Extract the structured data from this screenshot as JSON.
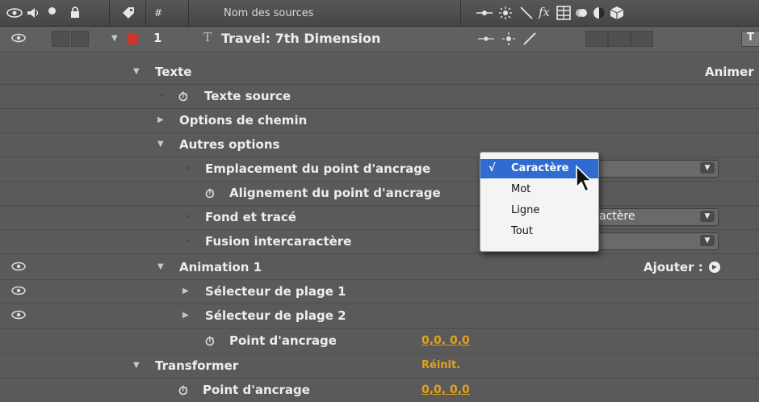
{
  "header": {
    "column_title": "Nom des sources",
    "left_icons": [
      "eye-icon",
      "speaker-icon",
      "solo-dot-icon",
      "lock-icon",
      "label-tag-icon",
      "hash-icon"
    ],
    "switch_icons": [
      "shy-icon",
      "collapse-sun-icon",
      "quality-slash-icon",
      "fx-icon",
      "frame-blend-icon",
      "motion-blur-icon",
      "adjustment-layer-icon",
      "3d-layer-icon"
    ],
    "fx_label": "fx"
  },
  "layer": {
    "number": "1",
    "type_glyph": "T",
    "name": "Travel: 7th Dimension",
    "label_color": "#d0352b",
    "right_cut": "T"
  },
  "rows": {
    "texte": "Texte",
    "animer_cut": "Animer",
    "texte_source": "Texte source",
    "options_chemin": "Options de chemin",
    "autres_options": "Autres options",
    "emplacement": "Emplacement du point d'ancrage",
    "alignement": "Alignement du point d'ancrage",
    "fond_trace": "Fond et tracé",
    "fond_trace_value": "actère",
    "fusion": "Fusion intercaractère",
    "animation1": "Animation 1",
    "ajouter": "Ajouter :",
    "selecteur1": "Sélecteur de plage 1",
    "selecteur2": "Sélecteur de plage 2",
    "point_ancrage_anim": "Point d'ancrage",
    "point_ancrage_anim_value": "0,0, 0,0",
    "transformer": "Transformer",
    "reinit": "Réinit.",
    "point_ancrage_tr": "Point d'ancrage",
    "point_ancrage_tr_value": "0,0, 0,0"
  },
  "dropdown_menu": {
    "checkmark": "√",
    "selected": "Caractère",
    "options": [
      "Caractère",
      "Mot",
      "Ligne",
      "Tout"
    ]
  },
  "colors": {
    "value_orange": "#e3a21e",
    "selection_blue": "#2f6bd0",
    "panel_bg": "#5a5a5a"
  }
}
